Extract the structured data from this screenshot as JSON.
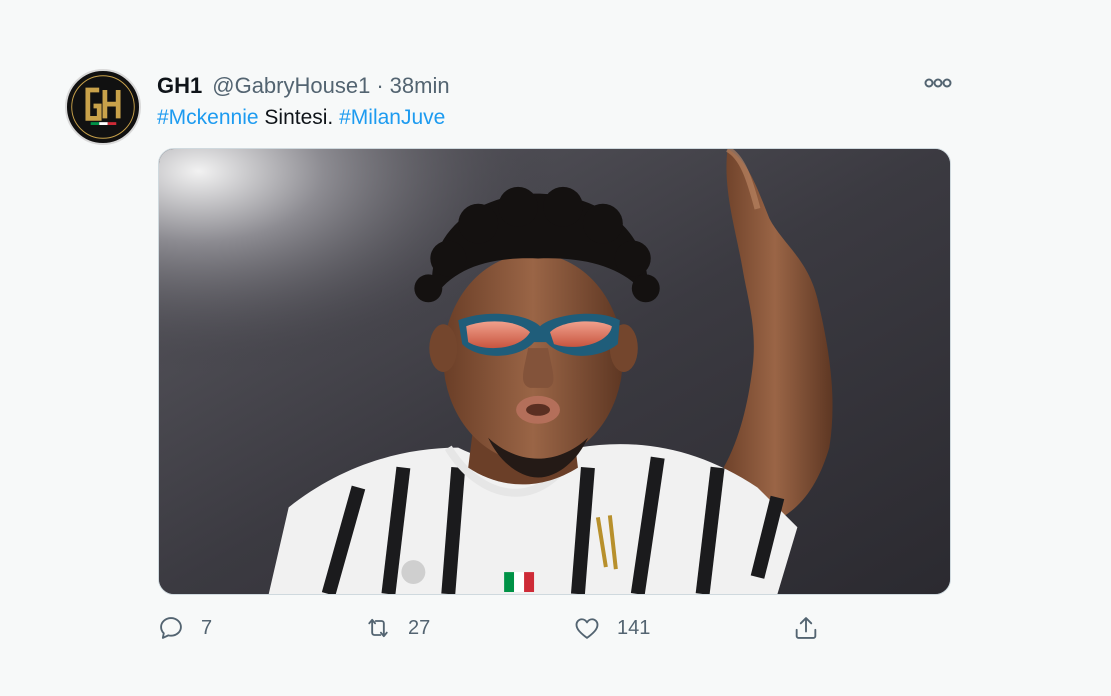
{
  "tweet": {
    "display_name": "GH1",
    "handle": "@GabryHouse1",
    "separator": "·",
    "time": "38min",
    "text": {
      "hashtag1": "#Mckennie",
      "plain": " Sintesi. ",
      "hashtag2": "#MilanJuve"
    },
    "avatar": {
      "monogram": "GH",
      "colors": {
        "background": "#111111",
        "gold": "#c9a24a",
        "green": "#009246",
        "red": "#ce2b37"
      }
    },
    "media": {
      "description_icon": "photo-of-player-with-red-sunglasses"
    },
    "actions": {
      "reply_count": "7",
      "retweet_count": "27",
      "like_count": "141"
    }
  },
  "icons": {
    "more": "more-horizontal-icon",
    "reply": "reply-icon",
    "retweet": "retweet-icon",
    "like": "heart-icon",
    "share": "share-icon"
  },
  "colors": {
    "text": "#0f1419",
    "secondary": "#536471",
    "link": "#1d9bf0",
    "background": "#f7f9f9"
  }
}
